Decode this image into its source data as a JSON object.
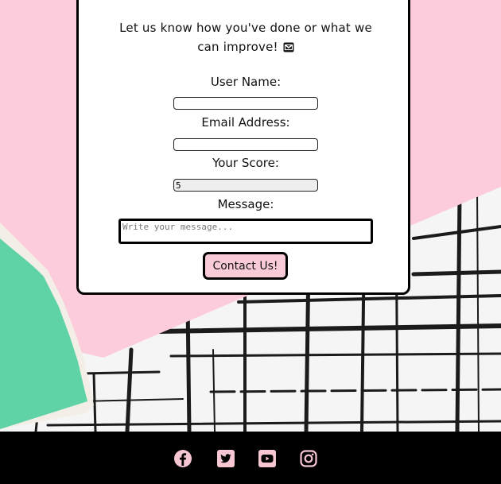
{
  "form": {
    "intro": "Let us know how you've done or what we can improve!",
    "intro_icon": "envelope-icon",
    "fields": {
      "username_label": "User Name:",
      "email_label": "Email Address:",
      "score_label": "Your Score:",
      "score_value": "5",
      "message_label": "Message:",
      "message_placeholder": "Write your message..."
    },
    "submit_label": "Contact Us!"
  },
  "footer": {
    "icons": [
      "facebook-icon",
      "twitter-icon",
      "youtube-icon",
      "instagram-icon"
    ]
  },
  "colors": {
    "pink": "#fccbdc",
    "button_pink": "#f8cbd7",
    "green": "#5fd3a5",
    "footer_bg": "#000000",
    "footer_icon": "#f7c6d3"
  }
}
